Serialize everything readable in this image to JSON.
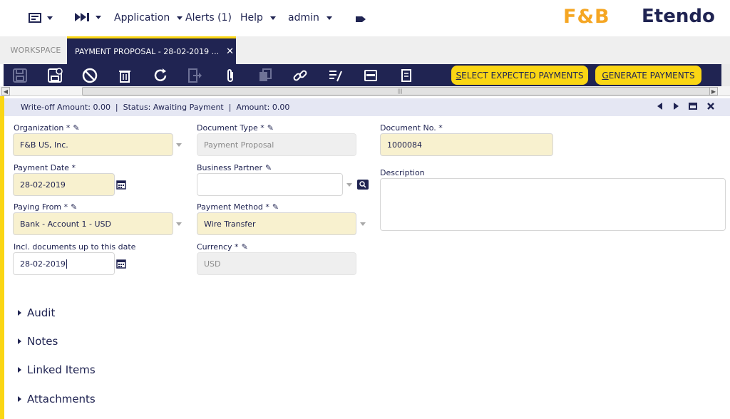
{
  "topbar": {
    "app_menu_label": "Application",
    "alerts_label": "Alerts (1)",
    "help_label": "Help",
    "user_label": "admin",
    "logo_fb": "F&B",
    "logo_etendo": "Etendo"
  },
  "tabs": {
    "workspace": "WORKSPACE",
    "active": "PAYMENT PROPOSAL - 28-02-2019 ...",
    "close_glyph": "✕"
  },
  "toolbar": {
    "select_payments_prefix": "S",
    "select_payments_rest": "ELECT EXPECTED PAYMENTS",
    "generate_payments_prefix": "G",
    "generate_payments_rest": "ENERATE PAYMENTS",
    "icons": [
      "save-icon",
      "save-close-icon",
      "undo-icon",
      "delete-icon",
      "refresh-icon",
      "export-icon",
      "attachment-icon",
      "clone-icon",
      "link-icon",
      "audit-icon",
      "grid-icon",
      "print-icon"
    ]
  },
  "status": {
    "text": "Write-off Amount: 0.00  |  Status: Awaiting Payment  |  Amount: 0.00"
  },
  "form": {
    "organization": {
      "label": "Organization *",
      "value": "F&B US, Inc."
    },
    "document_type": {
      "label": "Document Type *",
      "value": "Payment Proposal"
    },
    "document_no": {
      "label": "Document No. *",
      "value": "1000084"
    },
    "payment_date": {
      "label": "Payment Date *",
      "value": "28-02-2019"
    },
    "business_partner": {
      "label": "Business Partner",
      "value": ""
    },
    "description": {
      "label": "Description",
      "value": ""
    },
    "paying_from": {
      "label": "Paying From *",
      "value": "Bank - Account 1 - USD"
    },
    "payment_method": {
      "label": "Payment Method *",
      "value": "Wire Transfer"
    },
    "incl_docs": {
      "label": "Incl. documents up to this date",
      "value": "28-02-2019"
    },
    "currency": {
      "label": "Currency *",
      "value": "USD"
    }
  },
  "sections": {
    "audit": "Audit",
    "notes": "Notes",
    "linked_items": "Linked Items",
    "attachments": "Attachments"
  },
  "colors": {
    "navy": "#202452",
    "yellow": "#fad614",
    "required_bg": "#f8f1cf"
  }
}
